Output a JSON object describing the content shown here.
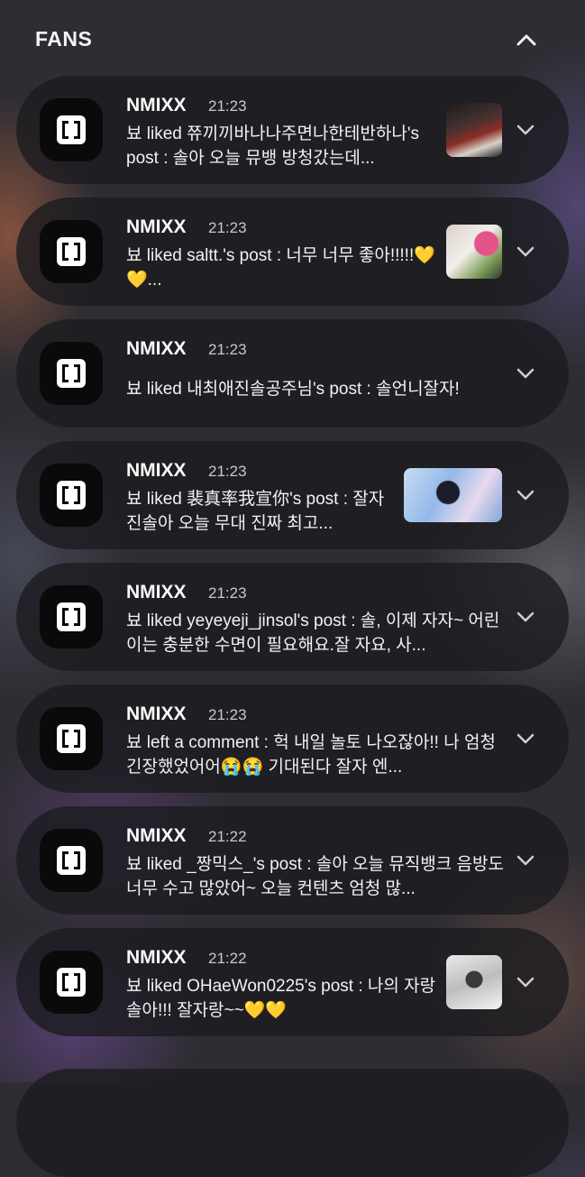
{
  "header": {
    "title": "FANS",
    "collapse_icon": "chevron-up-icon"
  },
  "notifications": [
    {
      "app": "NMIXX",
      "time": "21:23",
      "message": "뵤 liked 쮸끼끼바나나주면나한테반하나's post : 솔아 오늘 뮤뱅 방청갔는데...",
      "has_thumbnail": true
    },
    {
      "app": "NMIXX",
      "time": "21:23",
      "message": "뵤 liked saltt.'s post : 너무 너무 좋아!!!!!💛💛...",
      "has_thumbnail": true
    },
    {
      "app": "NMIXX",
      "time": "21:23",
      "message": "뵤 liked 내최애진솔공주님's post : 솔언니잘자!",
      "has_thumbnail": false
    },
    {
      "app": "NMIXX",
      "time": "21:23",
      "message": "뵤 liked 裴真率我宣你's post : 잘자 진솔아 오늘 무대 진짜 최고...",
      "has_thumbnail": true
    },
    {
      "app": "NMIXX",
      "time": "21:23",
      "message": "뵤 liked yeyeyeji_jinsol's post : 솔, 이제 자자~ 어린이는 충분한 수면이 필요해요.잘 자요, 사...",
      "has_thumbnail": false
    },
    {
      "app": "NMIXX",
      "time": "21:23",
      "message": "뵤 left a comment : 헉 내일 놀토 나오잖아!! 나 엄청 긴장했었어어😭😭 기대된다 잘자 엔...",
      "has_thumbnail": false
    },
    {
      "app": "NMIXX",
      "time": "21:22",
      "message": "뵤 liked _짱믹스_'s post : 솔아 오늘 뮤직뱅크 음방도 너무 수고 많았어~ 오늘 컨텐츠 엄청 많...",
      "has_thumbnail": false
    },
    {
      "app": "NMIXX",
      "time": "21:22",
      "message": "뵤 liked OHaeWon0225's post : 나의 자랑 솔아!!! 잘자랑~~💛💛",
      "has_thumbnail": true
    }
  ]
}
